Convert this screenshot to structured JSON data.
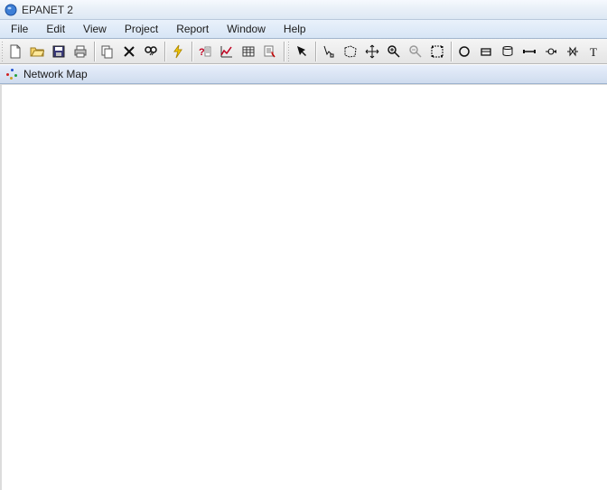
{
  "app": {
    "title": "EPANET 2"
  },
  "menus": {
    "file": "File",
    "edit": "Edit",
    "view": "View",
    "project": "Project",
    "report": "Report",
    "window": "Window",
    "help": "Help"
  },
  "panel": {
    "title": "Network Map"
  },
  "icons": {
    "new": "new",
    "open": "open",
    "save": "save",
    "print": "print",
    "copy": "copy",
    "delete": "delete",
    "find": "find",
    "run": "run",
    "query": "query",
    "graph": "graph",
    "table": "table",
    "options": "options",
    "select": "select",
    "vertex": "vertex",
    "region": "region",
    "pan": "pan",
    "zoomin": "zoomin",
    "zoomout": "zoomout",
    "extent": "extent",
    "junction": "junction",
    "reservoir": "reservoir",
    "tank": "tank",
    "pipe": "pipe",
    "pump": "pump",
    "valve": "valve",
    "label": "label"
  }
}
